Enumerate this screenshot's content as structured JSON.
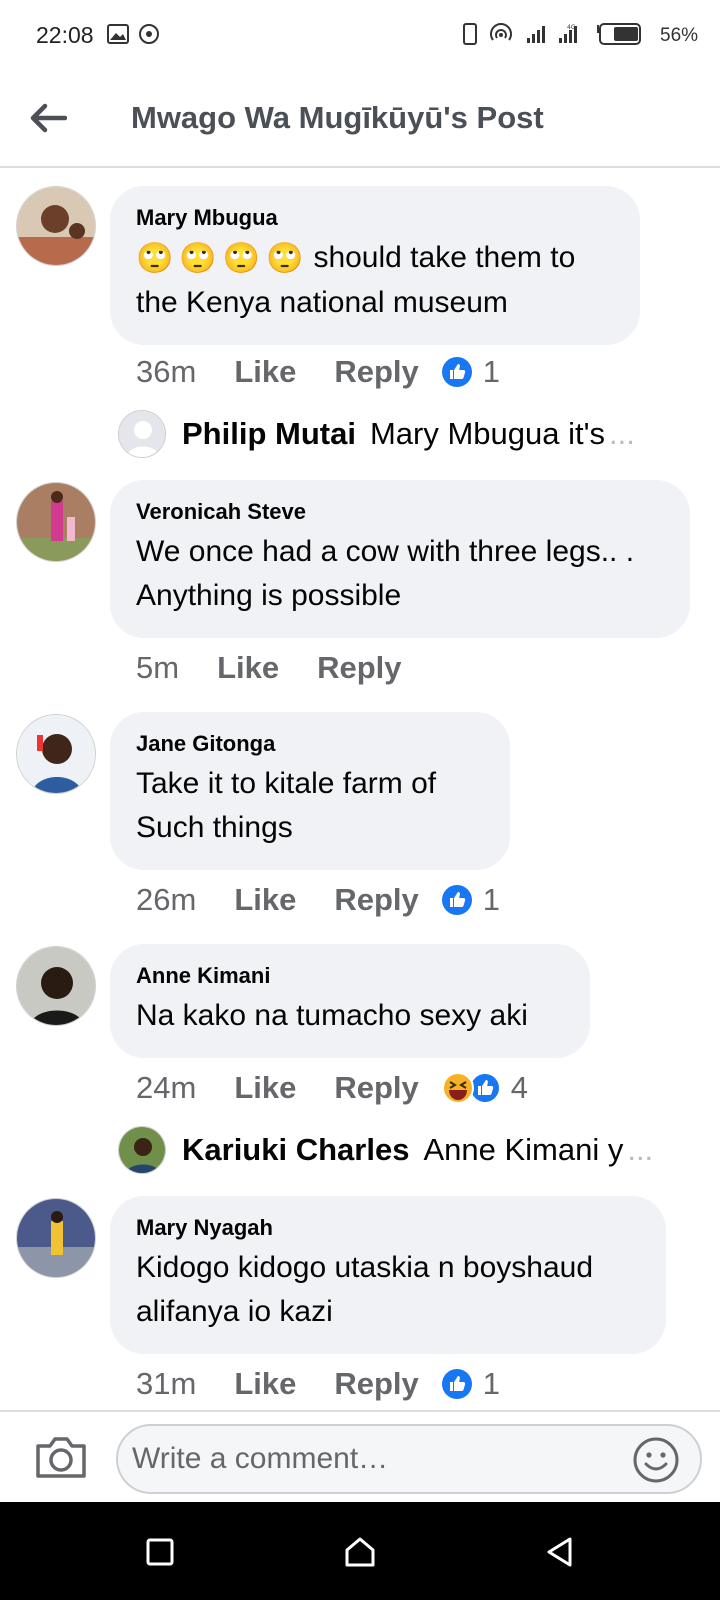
{
  "status_bar": {
    "time": "22:08",
    "battery_percent": "56%",
    "icons": [
      "gallery-icon",
      "sync-icon",
      "phone-outline-icon",
      "hotspot-icon",
      "signal-icon",
      "signal-data-icon",
      "battery-icon"
    ]
  },
  "header": {
    "title": "Mwago Wa Mugīkūyū's Post",
    "back_icon": "arrow-left-icon"
  },
  "comments": [
    {
      "author": "Mary Mbugua",
      "emoji_prefix": [
        "🙄",
        "🙄",
        "🙄",
        "🙄"
      ],
      "text": "should take them to the Kenya national museum",
      "time": "36m",
      "like_label": "Like",
      "reply_label": "Reply",
      "reactions": [
        "like"
      ],
      "reaction_count": "1",
      "reply_preview": {
        "author": "Philip Mutai",
        "text": "Mary Mbugua it's",
        "ellipsis": "..."
      }
    },
    {
      "author": "Veronicah Steve",
      "text": "We once had a cow with three legs.. . Anything is possible",
      "time": "5m",
      "like_label": "Like",
      "reply_label": "Reply"
    },
    {
      "author": "Jane Gitonga",
      "text": "Take it to kitale farm of Such things",
      "time": "26m",
      "like_label": "Like",
      "reply_label": "Reply",
      "reactions": [
        "like"
      ],
      "reaction_count": "1"
    },
    {
      "author": "Anne Kimani",
      "text": "Na kako na tumacho sexy aki",
      "time": "24m",
      "like_label": "Like",
      "reply_label": "Reply",
      "reactions": [
        "haha",
        "like"
      ],
      "reaction_count": "4",
      "reply_preview": {
        "author": "Kariuki Charles",
        "text": "Anne Kimani y",
        "ellipsis": "..."
      }
    },
    {
      "author": "Mary Nyagah",
      "text": "Kidogo kidogo utaskia n boyshaud alifanya io kazi",
      "time": "31m",
      "like_label": "Like",
      "reply_label": "Reply",
      "reactions": [
        "like"
      ],
      "reaction_count": "1"
    }
  ],
  "composer": {
    "placeholder": "Write a comment…",
    "camera_icon": "camera-icon",
    "emoji_icon": "emoji-smile-icon"
  },
  "nav_bar": {
    "buttons": [
      "recents-square-icon",
      "home-icon",
      "back-triangle-icon"
    ]
  },
  "colors": {
    "bubble_bg": "#f0f2f5",
    "meta_text": "#65676b",
    "like_blue": "#1877f2",
    "header_title": "#4b4f56",
    "divider": "#dadde1"
  }
}
